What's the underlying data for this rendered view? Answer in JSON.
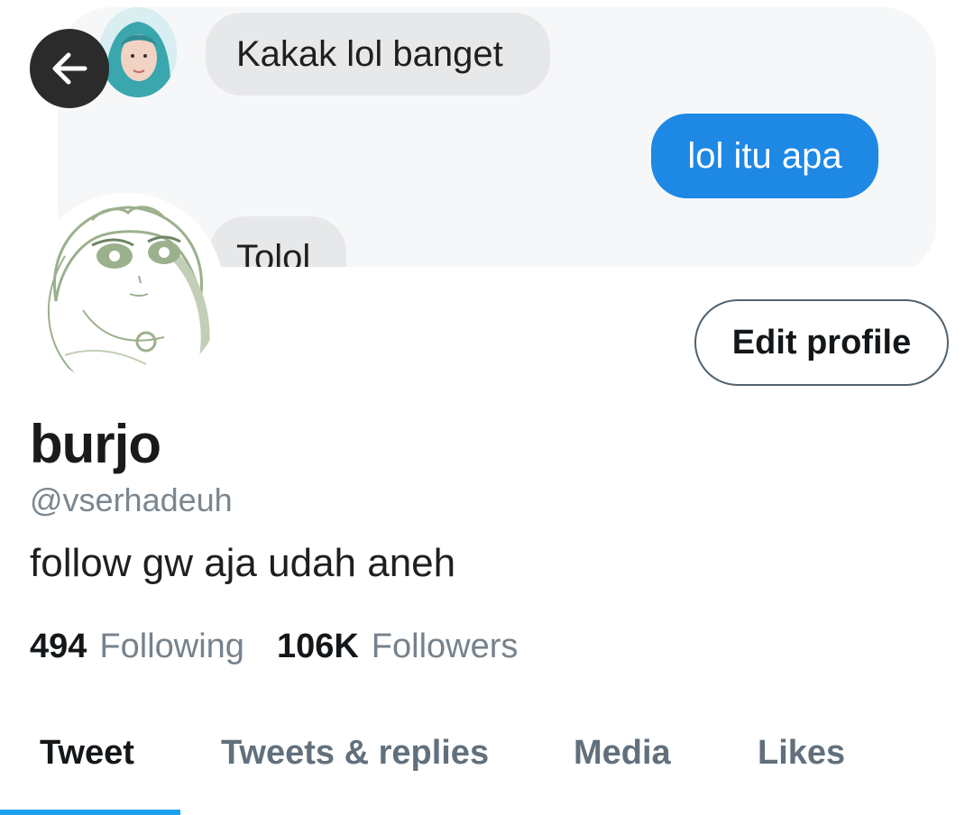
{
  "banner": {
    "messages": [
      {
        "text": "Kakak lol banget",
        "side": "incoming"
      },
      {
        "text": "lol itu apa",
        "side": "outgoing"
      },
      {
        "text": "Tolol",
        "side": "incoming"
      }
    ]
  },
  "header": {
    "back_icon": "arrow-left-icon"
  },
  "profile": {
    "edit_label": "Edit profile",
    "display_name": "burjo",
    "handle": "@vserhadeuh",
    "bio": "follow gw aja udah aneh",
    "following_count": "494",
    "following_label": "Following",
    "followers_count": "106K",
    "followers_label": "Followers"
  },
  "tabs": [
    {
      "label": "Tweet",
      "active": true
    },
    {
      "label": "Tweets & replies",
      "active": false
    },
    {
      "label": "Media",
      "active": false
    },
    {
      "label": "Likes",
      "active": false
    }
  ],
  "colors": {
    "accent": "#1da1f2",
    "bubble_out": "#1e88e5",
    "bubble_in": "#e7e8ea"
  }
}
